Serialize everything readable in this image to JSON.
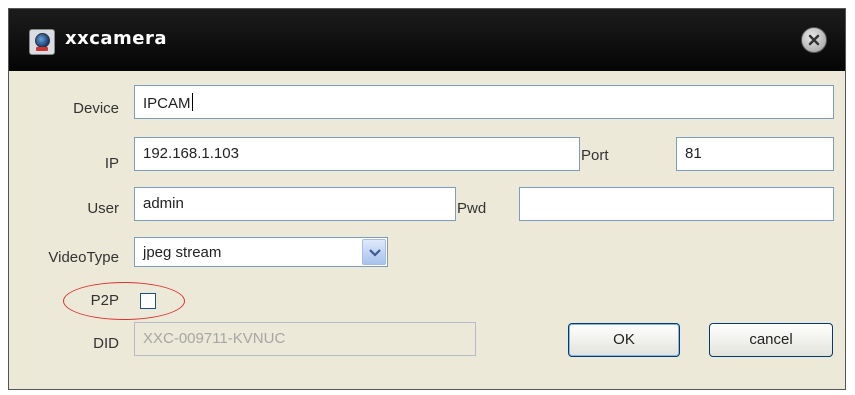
{
  "window": {
    "title": "xxcamera"
  },
  "form": {
    "device": {
      "label": "Device",
      "value": "IPCAM"
    },
    "ip": {
      "label": "IP",
      "value": "192.168.1.103"
    },
    "port": {
      "label": "Port",
      "value": "81"
    },
    "user": {
      "label": "User",
      "value": "admin"
    },
    "pwd": {
      "label": "Pwd",
      "value": ""
    },
    "video_type": {
      "label": "VideoType",
      "selected": "jpeg stream"
    },
    "p2p": {
      "label": "P2P",
      "checked": false
    },
    "did": {
      "label": "DID",
      "value": "XXC-009711-KVNUC"
    }
  },
  "buttons": {
    "ok": "OK",
    "cancel": "cancel"
  },
  "colors": {
    "titlebar": "#0a0a0a",
    "dialog_bg": "#ece9d8",
    "highlight": "#dd3333"
  }
}
